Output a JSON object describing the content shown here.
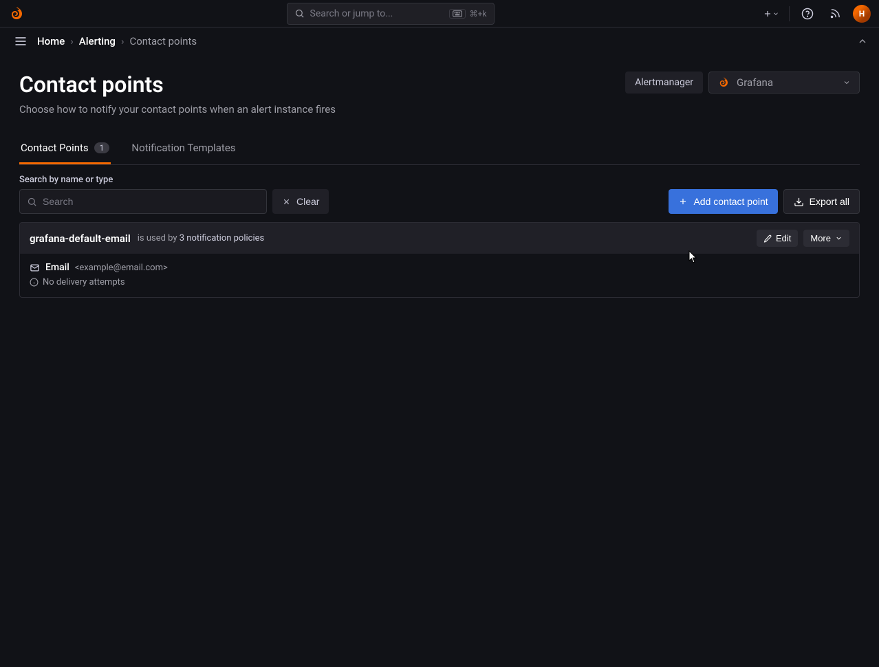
{
  "topbar": {
    "search_placeholder": "Search or jump to...",
    "kbd_hint": "⌘+k"
  },
  "breadcrumb": {
    "home": "Home",
    "alerting": "Alerting",
    "current": "Contact points"
  },
  "page": {
    "title": "Contact points",
    "subtitle": "Choose how to notify your contact points when an alert instance fires"
  },
  "alertmanager": {
    "label": "Alertmanager",
    "selected": "Grafana"
  },
  "tabs": {
    "contact_points": "Contact Points",
    "contact_points_count": "1",
    "notification_templates": "Notification Templates"
  },
  "toolbar": {
    "search_label": "Search by name or type",
    "search_placeholder": "Search",
    "clear": "Clear",
    "add": "Add contact point",
    "export_all": "Export all"
  },
  "contact_point": {
    "name": "grafana-default-email",
    "used_by_prefix": "is used by",
    "used_by_count": "3 notification policies",
    "edit": "Edit",
    "more": "More",
    "type": "Email",
    "address": "<example@email.com>",
    "status": "No delivery attempts"
  }
}
